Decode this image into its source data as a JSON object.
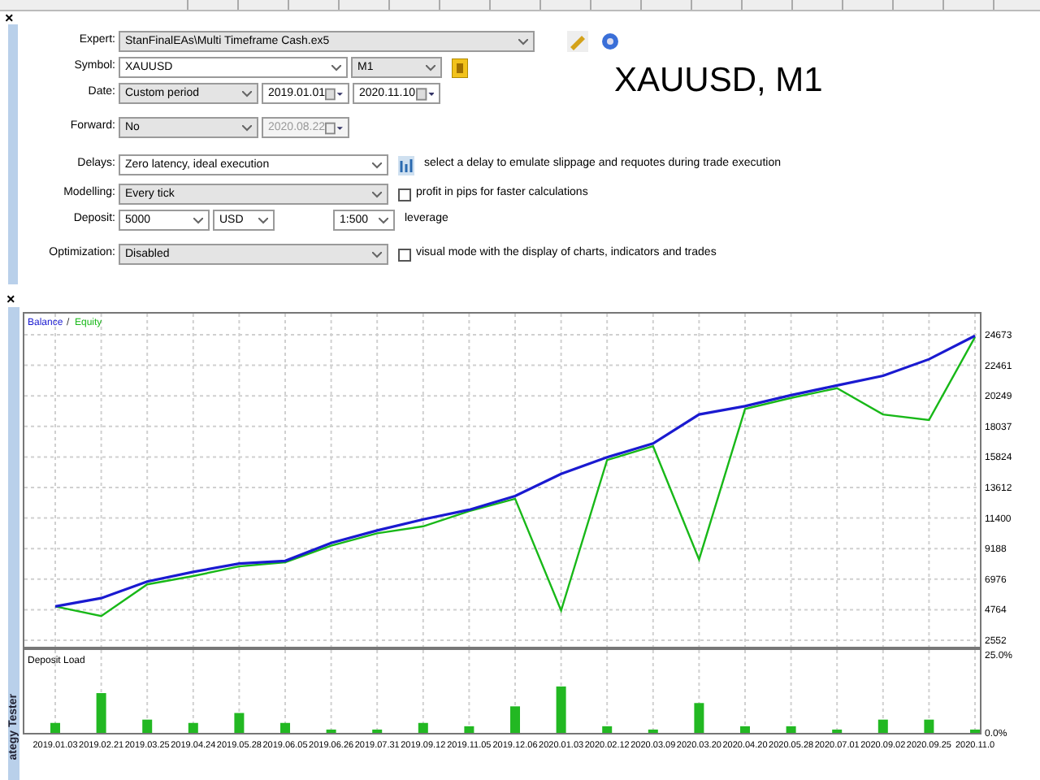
{
  "close_marks": [
    "×",
    "×"
  ],
  "settings": {
    "rows": [
      {
        "label": "Expert:",
        "fields": [
          {
            "kind": "select",
            "value": "StanFinalEAs\\Multi Timeframe Cash.ex5"
          },
          {
            "kind": "edit-icon"
          },
          {
            "kind": "gear-icon"
          }
        ]
      },
      {
        "label": "Symbol:",
        "fields": [
          {
            "kind": "combo",
            "value": "XAUUSD"
          },
          {
            "kind": "select",
            "value": "M1"
          },
          {
            "kind": "info-icon"
          }
        ]
      },
      {
        "label": "Date:",
        "fields": [
          {
            "kind": "select",
            "value": "Custom period"
          },
          {
            "kind": "date",
            "value": "2019.01.01",
            "disabled": false
          },
          {
            "kind": "date",
            "value": "2020.11.10",
            "disabled": false
          }
        ]
      },
      {
        "label": "Forward:",
        "fields": [
          {
            "kind": "select",
            "value": "No"
          },
          {
            "kind": "date",
            "value": "2020.08.22",
            "disabled": true
          }
        ]
      },
      {
        "label": "Delays:",
        "fields": [
          {
            "kind": "combo",
            "value": "Zero latency, ideal execution"
          },
          {
            "kind": "chart-icon"
          },
          {
            "kind": "note",
            "value": "select a delay to emulate slippage and requotes during trade execution"
          }
        ]
      },
      {
        "label": "Modelling:",
        "fields": [
          {
            "kind": "select",
            "value": "Every tick"
          },
          {
            "kind": "checkbox",
            "value": "profit in pips for faster calculations",
            "checked": false
          }
        ]
      },
      {
        "label": "Deposit:",
        "fields": [
          {
            "kind": "combo",
            "value": "5000"
          },
          {
            "kind": "combo",
            "value": "USD"
          },
          {
            "kind": "gap"
          },
          {
            "kind": "combo",
            "value": "1:500"
          },
          {
            "kind": "note",
            "value": "leverage"
          }
        ]
      },
      {
        "label": "Optimization:",
        "fields": [
          {
            "kind": "select",
            "value": "Disabled"
          },
          {
            "kind": "checkbox",
            "value": "visual mode with the display of charts, indicators and trades",
            "checked": false
          }
        ]
      }
    ]
  },
  "symbol_caption": "XAUUSD, M1",
  "side_tab": "ategy Tester",
  "balance_chart": {
    "legend_sep": "/",
    "chart_data": {
      "type": "line",
      "grid": true,
      "yticks": [
        24673,
        22461,
        20249,
        18037,
        15824,
        13612,
        11400,
        9188,
        6976,
        4764,
        2552
      ],
      "ylim": [
        2552,
        24673
      ],
      "series": [
        {
          "name": "Balance",
          "color": "#1a1ad0",
          "values": [
            5000,
            5600,
            6800,
            7500,
            8100,
            8300,
            9600,
            10500,
            11300,
            12000,
            13000,
            14600,
            15800,
            16800,
            18900,
            19500,
            20300,
            21000,
            21700,
            22900,
            24600
          ]
        },
        {
          "name": "Equity",
          "color": "#18b818",
          "values": [
            5000,
            4300,
            6600,
            7200,
            7900,
            8200,
            9400,
            10300,
            10800,
            11900,
            12800,
            4700,
            15600,
            16600,
            8400,
            19300,
            20100,
            20800,
            18900,
            18500,
            24500
          ]
        }
      ]
    }
  },
  "load_chart": {
    "chart_data": {
      "type": "bar",
      "grid": true,
      "categories": [
        "2019.01.03",
        "2019.02.21",
        "2019.03.25",
        "2019.04.24",
        "2019.05.28",
        "2019.06.05",
        "2019.06.26",
        "2019.07.31",
        "2019.09.12",
        "2019.11.05",
        "2019.12.06",
        "2020.01.03",
        "2020.02.12",
        "2020.03.09",
        "2020.03.20",
        "2020.04.20",
        "2020.05.28",
        "2020.07.01",
        "2020.09.02",
        "2020.09.25",
        "2020.11.0"
      ],
      "yticks": [
        {
          "value": 25,
          "label": "25.0%"
        },
        {
          "value": 0,
          "label": "0.0%"
        }
      ],
      "ylim": [
        0,
        25
      ],
      "series": [
        {
          "name": "Deposit Load",
          "color": "#22b822",
          "values": [
            3,
            12,
            4,
            3,
            6,
            3,
            1,
            1,
            3,
            2,
            8,
            14,
            2,
            1,
            9,
            2,
            2,
            1,
            4,
            4,
            1
          ]
        }
      ]
    }
  }
}
